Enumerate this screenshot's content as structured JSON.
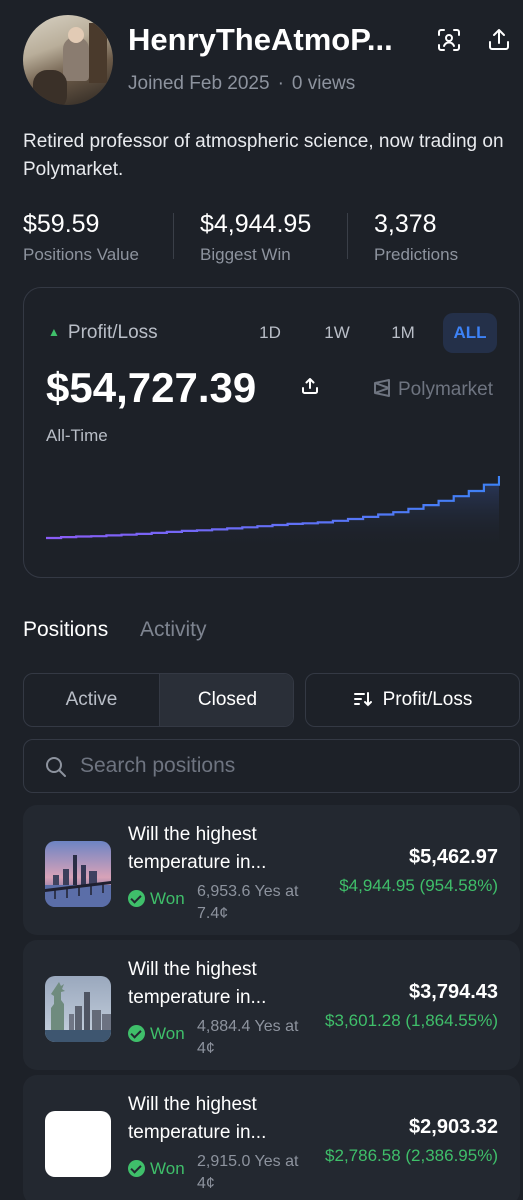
{
  "profile": {
    "username": "HenryTheAtmoP...",
    "joined": "Joined Feb 2025",
    "separator": "·",
    "views": "0 views",
    "bio": "Retired professor of atmospheric science, now trading on Polymarket."
  },
  "stats": [
    {
      "value": "$59.59",
      "label": "Positions Value"
    },
    {
      "value": "$4,944.95",
      "label": "Biggest Win"
    },
    {
      "value": "3,378",
      "label": "Predictions"
    }
  ],
  "pnl_card": {
    "label": "Profit/Loss",
    "ranges": [
      "1D",
      "1W",
      "1M",
      "ALL"
    ],
    "active_range": "ALL",
    "value": "$54,727.39",
    "period": "All-Time",
    "brand": "Polymarket",
    "line_gradient": [
      "#8b5cf6",
      "#3d82f6"
    ]
  },
  "chart_data": {
    "type": "area",
    "series": [
      {
        "values": [
          0,
          0.8,
          1.3,
          1.6,
          2.3,
          2.9,
          3.6,
          4.5,
          5.4,
          6.3,
          6.8,
          7.6,
          8.5,
          9.4,
          10.4,
          11.5,
          12.4,
          13.0,
          13.8,
          15.2,
          16.8,
          18.6,
          20.7,
          22.8,
          25.8,
          29.0,
          32.8,
          36.9,
          41.5,
          47.0,
          54.7
        ]
      }
    ]
  },
  "tabs": {
    "positions": "Positions",
    "activity": "Activity"
  },
  "filter": {
    "active": "Active",
    "closed": "Closed",
    "sort": "Profit/Loss"
  },
  "search": {
    "placeholder": "Search positions"
  },
  "positions": [
    {
      "question": "Will the highest temperature in...",
      "status": "Won",
      "shares": "6,953.6 Yes at 7.4¢",
      "value": "$5,462.97",
      "pnl": "$4,944.95 (954.58%)"
    },
    {
      "question": "Will the highest temperature in...",
      "status": "Won",
      "shares": "4,884.4 Yes at 4¢",
      "value": "$3,794.43",
      "pnl": "$3,601.28 (1,864.55%)"
    },
    {
      "question": "Will the highest temperature in...",
      "status": "Won",
      "shares": "2,915.0 Yes at 4¢",
      "value": "$2,903.32",
      "pnl": "$2,786.58 (2,386.95%)"
    }
  ]
}
